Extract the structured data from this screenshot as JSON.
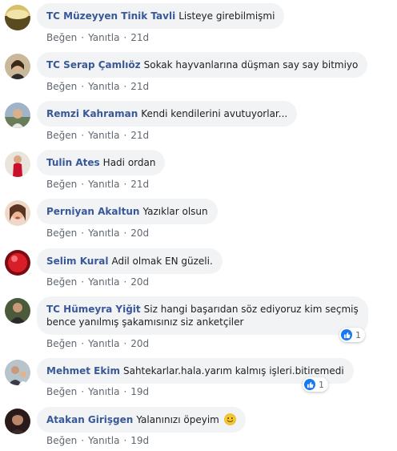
{
  "actions": {
    "like": "Beğen",
    "reply": "Yanıtla",
    "separator": "·"
  },
  "comments": [
    {
      "author": "TC Müzeyyen Tinik Tavli",
      "text": "Listeye girebilmişmi",
      "time": "21d"
    },
    {
      "author": "TC Serap Çamlıöz",
      "text": "Sokak hayvanlarına düşman say say bitmiyo",
      "time": "21d"
    },
    {
      "author": "Remzi Kahraman",
      "text": "Kendi kendilerini avutuyorlar...",
      "time": "21d"
    },
    {
      "author": "Tulin Ates",
      "text": "Hadi ordan",
      "time": "21d"
    },
    {
      "author": "Perniyan Akaltun",
      "text": "Yazıklar olsun",
      "time": "20d"
    },
    {
      "author": "Selim Kural",
      "text": "Adil olmak EN güzeli.",
      "time": "20d"
    },
    {
      "author": "TC Hümeyra Yiğit",
      "text": "Siz hangi başarıdan söz ediyoruz kim seçmiş bence yanılmış şakamısınız siz anketçiler",
      "time": "20d",
      "reaction_count": "1"
    },
    {
      "author": "Mehmet Ekim",
      "text": "Sahtekarlar.hala.yarım kalmış işleri.bitiremedi",
      "time": "19d",
      "reaction_count": "1"
    },
    {
      "author": "Atakan Girişgen",
      "text": "Yalanınızı öpeyim",
      "time": "19d",
      "emoji": "smiling-face"
    }
  ],
  "colors": {
    "author": "#385898",
    "bubble": "#f2f3f5",
    "meta": "#606770",
    "like": "#1877f2"
  }
}
